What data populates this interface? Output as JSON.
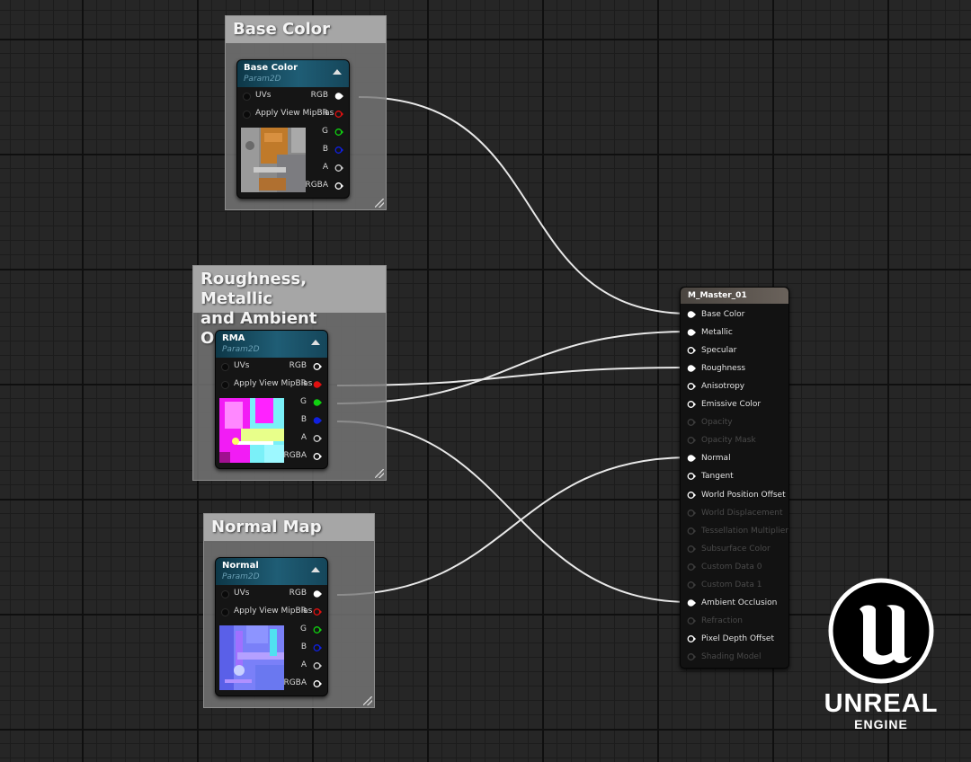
{
  "comments": {
    "base_color": {
      "title": "Base Color"
    },
    "rma": {
      "title_line1": "Roughness, Metallic",
      "title_line2": "and Ambient Occlusion"
    },
    "normal": {
      "title": "Normal Map"
    }
  },
  "nodes": {
    "base_color": {
      "title": "Base Color",
      "subtitle": "Param2D"
    },
    "rma": {
      "title": "RMA",
      "subtitle": "Param2D"
    },
    "normal": {
      "title": "Normal",
      "subtitle": "Param2D"
    }
  },
  "texture_pins": {
    "inputs": [
      "UVs",
      "Apply View MipBias"
    ],
    "outputs": [
      "RGB",
      "R",
      "G",
      "B",
      "A",
      "RGBA"
    ]
  },
  "pin_colors": {
    "RGB": "#ffffff",
    "R": "#e01010",
    "G": "#10d010",
    "B": "#1020e0",
    "A": "#cccccc",
    "RGBA": "#ffffff"
  },
  "material": {
    "title": "M_Master_01",
    "pins": [
      {
        "label": "Base Color",
        "enabled": true,
        "connected": true
      },
      {
        "label": "Metallic",
        "enabled": true,
        "connected": true
      },
      {
        "label": "Specular",
        "enabled": true,
        "connected": false
      },
      {
        "label": "Roughness",
        "enabled": true,
        "connected": true
      },
      {
        "label": "Anisotropy",
        "enabled": true,
        "connected": false
      },
      {
        "label": "Emissive Color",
        "enabled": true,
        "connected": false
      },
      {
        "label": "Opacity",
        "enabled": false,
        "connected": false
      },
      {
        "label": "Opacity Mask",
        "enabled": false,
        "connected": false
      },
      {
        "label": "Normal",
        "enabled": true,
        "connected": true
      },
      {
        "label": "Tangent",
        "enabled": true,
        "connected": false
      },
      {
        "label": "World Position Offset",
        "enabled": true,
        "connected": false
      },
      {
        "label": "World Displacement",
        "enabled": false,
        "connected": false
      },
      {
        "label": "Tessellation Multiplier",
        "enabled": false,
        "connected": false
      },
      {
        "label": "Subsurface Color",
        "enabled": false,
        "connected": false
      },
      {
        "label": "Custom Data 0",
        "enabled": false,
        "connected": false
      },
      {
        "label": "Custom Data 1",
        "enabled": false,
        "connected": false
      },
      {
        "label": "Ambient Occlusion",
        "enabled": true,
        "connected": true
      },
      {
        "label": "Refraction",
        "enabled": false,
        "connected": false
      },
      {
        "label": "Pixel Depth Offset",
        "enabled": true,
        "connected": false
      },
      {
        "label": "Shading Model",
        "enabled": false,
        "connected": false
      }
    ]
  },
  "connections": [
    {
      "from_node": "Base Color",
      "from_pin": "RGB",
      "to_pin": "Base Color"
    },
    {
      "from_node": "RMA",
      "from_pin": "R",
      "to_pin": "Roughness"
    },
    {
      "from_node": "RMA",
      "from_pin": "G",
      "to_pin": "Metallic"
    },
    {
      "from_node": "RMA",
      "from_pin": "B",
      "to_pin": "Ambient Occlusion"
    },
    {
      "from_node": "Normal",
      "from_pin": "RGB",
      "to_pin": "Normal"
    }
  ],
  "logo": {
    "word": "UNREAL",
    "sub": "ENGINE"
  }
}
